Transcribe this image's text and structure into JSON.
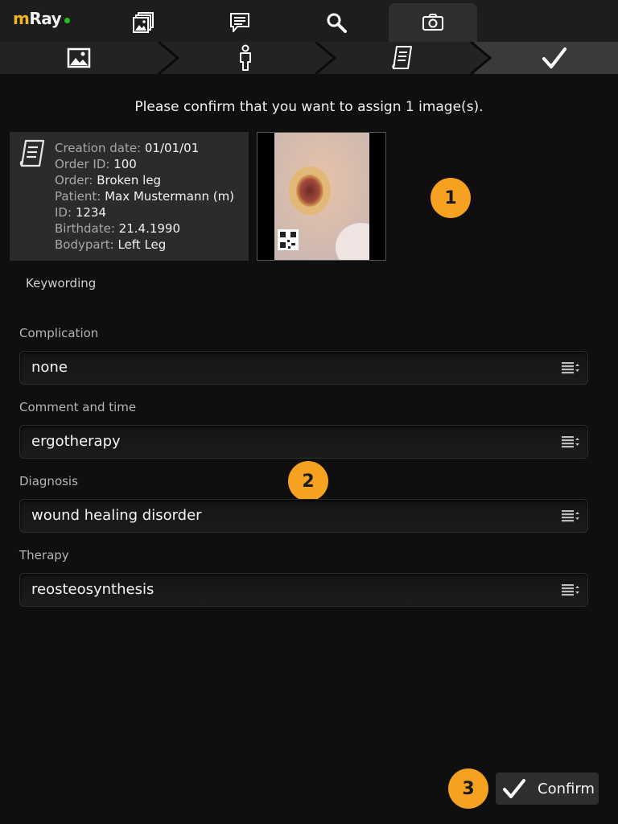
{
  "app": {
    "logo_m": "m",
    "logo_ray": "Ray",
    "status_color": "#1ec21e",
    "accent": "#f6a11f"
  },
  "top_tabs": [
    {
      "icon": "gallery-icon"
    },
    {
      "icon": "comment-icon"
    },
    {
      "icon": "search-icon"
    },
    {
      "icon": "camera-icon",
      "active": true
    }
  ],
  "steps": [
    {
      "icon": "image-icon"
    },
    {
      "icon": "patient-icon"
    },
    {
      "icon": "order-icon"
    },
    {
      "icon": "checkmark-icon",
      "active": true
    }
  ],
  "message": "Please confirm that you want to assign 1 image(s).",
  "order": {
    "icon": "order-document-icon",
    "creation_date_label": "Creation date:",
    "creation_date": "01/01/01",
    "order_id_label": "Order ID:",
    "order_id": "100",
    "order_label": "Order:",
    "order": "Broken leg",
    "patient_label": "Patient:",
    "patient": "Max Mustermann (m)",
    "id_label": "ID:",
    "id": "1234",
    "birthdate_label": "Birthdate:",
    "birthdate": "21.4.1990",
    "bodypart_label": "Bodypart:",
    "bodypart": "Left Leg"
  },
  "badges": {
    "one": "1",
    "two": "2",
    "three": "3"
  },
  "keywording": {
    "title": "Keywording",
    "complication": {
      "label": "Complication",
      "value": "none"
    },
    "comment": {
      "label": "Comment and time",
      "value": "ergotherapy"
    },
    "diagnosis": {
      "label": "Diagnosis",
      "value": "wound healing disorder"
    },
    "therapy": {
      "label": "Therapy",
      "value": "reosteosynthesis"
    }
  },
  "confirm_button": {
    "label": "Confirm"
  }
}
